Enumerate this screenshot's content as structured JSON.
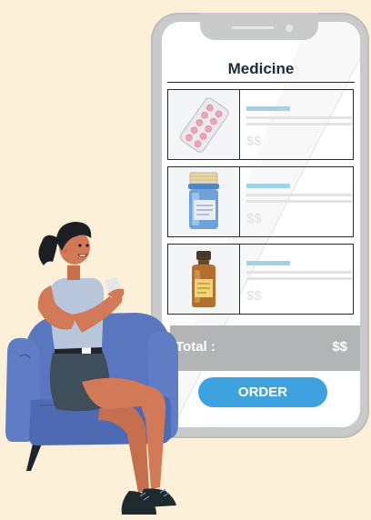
{
  "screen": {
    "title": "Medicine",
    "items": [
      {
        "price": "$$",
        "image": "pill-blister-pack-icon"
      },
      {
        "price": "$$",
        "image": "blue-medicine-bottle-icon"
      },
      {
        "price": "$$",
        "image": "brown-medicine-bottle-icon"
      }
    ],
    "total_label": "Total :",
    "total_value": "$$",
    "order_label": "ORDER"
  },
  "colors": {
    "background": "#FCF0D8",
    "phone_frame": "#C9CACC",
    "accent_blue": "#3DA2DE",
    "total_bar": "#B3B4B6",
    "sofa": "#5A76BF"
  }
}
